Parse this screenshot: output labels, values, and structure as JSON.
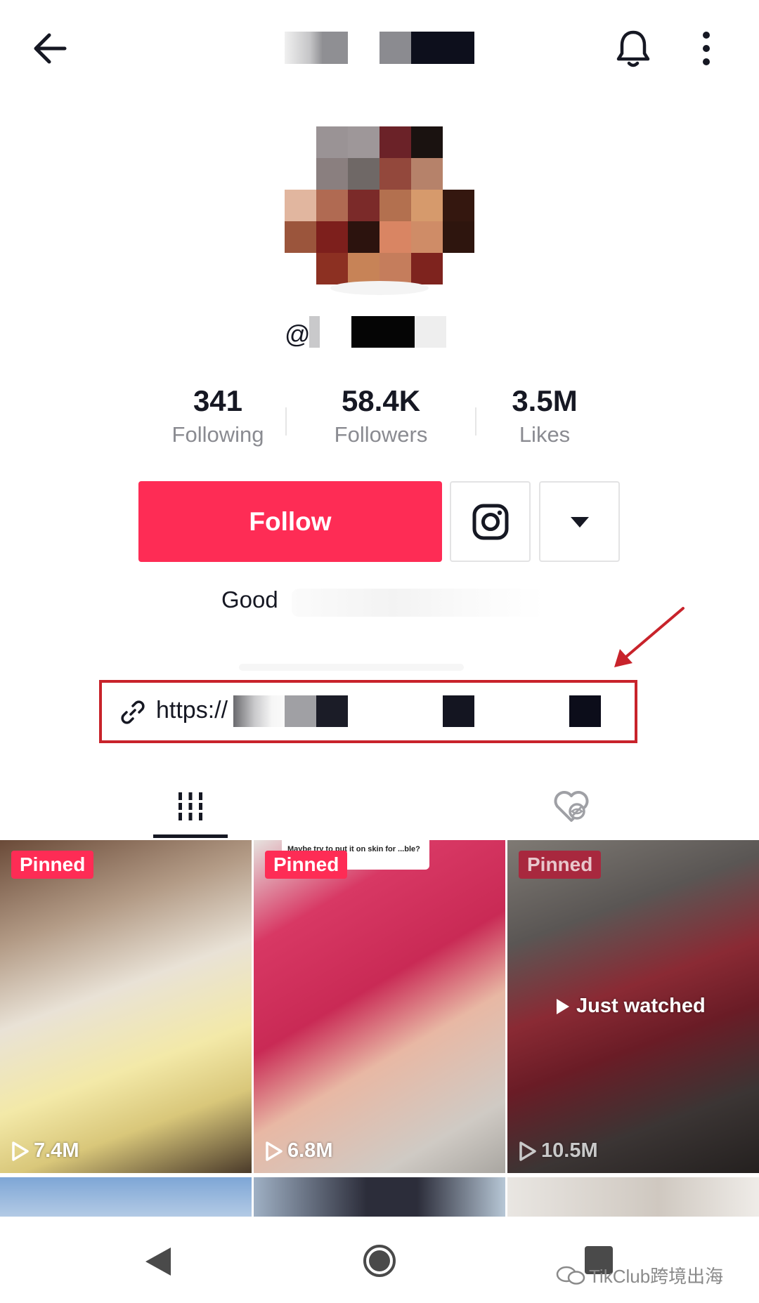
{
  "profile": {
    "username_prefix": "@",
    "stats": [
      {
        "value": "341",
        "label": "Following"
      },
      {
        "value": "58.4K",
        "label": "Followers"
      },
      {
        "value": "3.5M",
        "label": "Likes"
      }
    ],
    "follow_label": "Follow",
    "bio_visible": "Good",
    "link_prefix": "https://"
  },
  "videos": [
    {
      "badge": "Pinned",
      "views": "7.4M"
    },
    {
      "badge": "Pinned",
      "views": "6.8M",
      "caption": "Maybe try to put it on skin for ...ble?"
    },
    {
      "badge": "Pinned",
      "views": "10.5M",
      "overlay": "Just watched"
    }
  ],
  "watermark": "TikClub跨境出海",
  "colors": {
    "accent": "#fe2c55",
    "annotation": "#c8232b"
  },
  "icons": {
    "back": "arrow-left-icon",
    "bell": "bell-icon",
    "more": "more-vertical-icon",
    "instagram": "instagram-icon",
    "dropdown": "caret-down-icon",
    "link": "link-icon",
    "videos_tab": "grid-icon",
    "liked_tab": "heart-hidden-icon"
  }
}
